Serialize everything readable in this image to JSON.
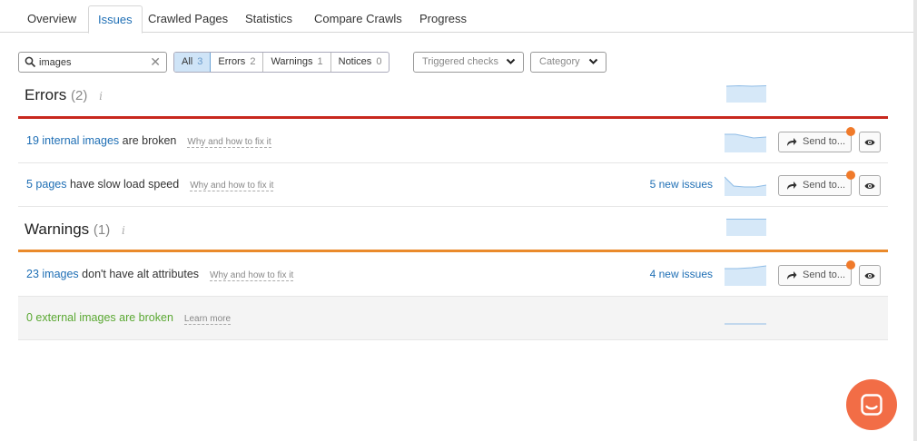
{
  "tabs": [
    {
      "label": "Overview"
    },
    {
      "label": "Issues"
    },
    {
      "label": "Crawled Pages"
    },
    {
      "label": "Statistics"
    },
    {
      "label": "Compare Crawls"
    },
    {
      "label": "Progress"
    }
  ],
  "active_tab": "Issues",
  "search": {
    "value": "images",
    "clear_glyph": "✕"
  },
  "filters": [
    {
      "label": "All",
      "count": "3"
    },
    {
      "label": "Errors",
      "count": "2"
    },
    {
      "label": "Warnings",
      "count": "1"
    },
    {
      "label": "Notices",
      "count": "0"
    }
  ],
  "selected_filter": "All",
  "dropdowns": {
    "triggered": "Triggered checks",
    "category": "Category"
  },
  "errors_section": {
    "title": "Errors",
    "count": "(2)",
    "info": "i"
  },
  "warnings_section": {
    "title": "Warnings",
    "count": "(1)",
    "info": "i"
  },
  "rows": [
    {
      "link": "19 internal images",
      "rest": " are broken",
      "help": "Why and how to fix it",
      "new_issues": "",
      "send": "Send to..."
    },
    {
      "link": "5 pages",
      "rest": " have slow load speed",
      "help": "Why and how to fix it",
      "new_issues": "5 new issues",
      "send": "Send to..."
    },
    {
      "link": "23 images",
      "rest": " don't have alt attributes",
      "help": "Why and how to fix it",
      "new_issues": "4 new issues",
      "send": "Send to..."
    },
    {
      "text": "0 external images are broken",
      "help": "Learn more"
    }
  ],
  "colors": {
    "error_rule": "#c8281e",
    "warning_rule": "#ea8a2b",
    "link": "#1f6fb5",
    "accent_dot": "#f07a2a",
    "chat": "#f26d46",
    "ok_green": "#5aa832"
  },
  "icons": [
    "search-icon",
    "clear-icon",
    "chevron-down-icon",
    "info-icon",
    "share-arrow-icon",
    "eye-icon",
    "chat-icon"
  ]
}
